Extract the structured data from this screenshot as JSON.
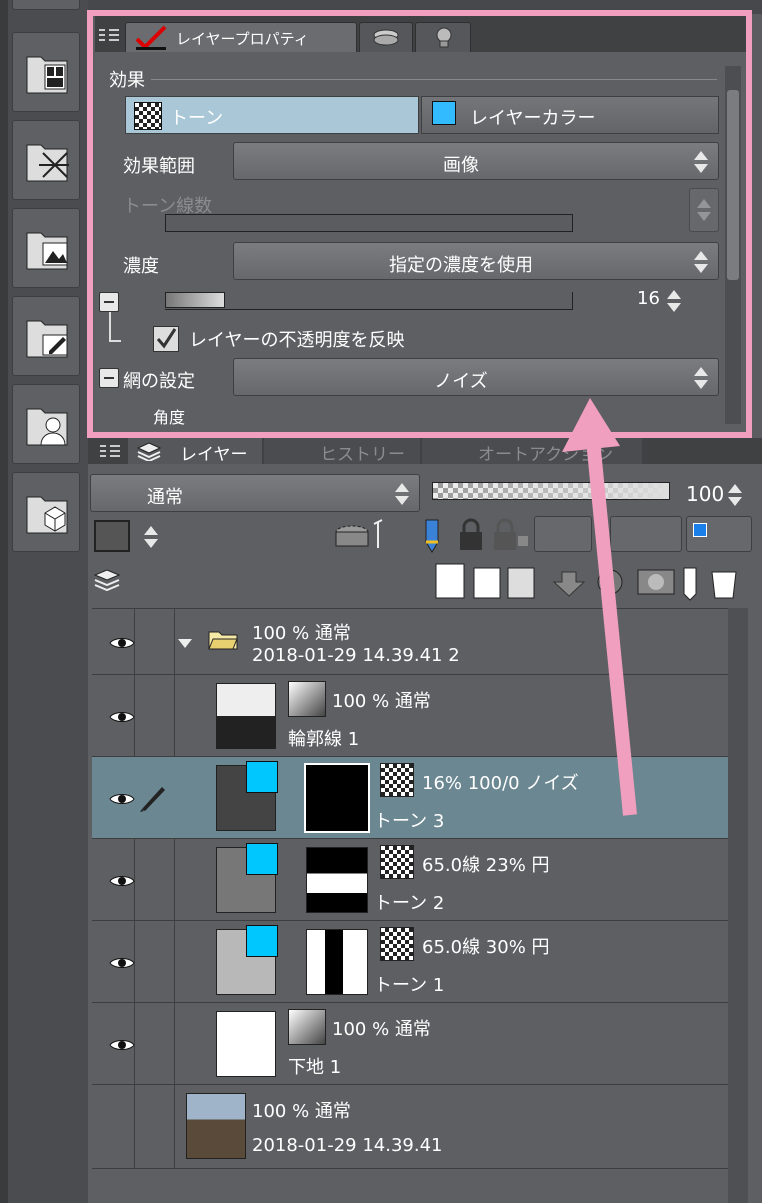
{
  "property_panel": {
    "tabs": [
      "レイヤープロパティ"
    ],
    "section_title": "効果",
    "effect_buttons": {
      "tone": "トーン",
      "layer_color": "レイヤーカラー"
    },
    "effect_range": {
      "label": "効果範囲",
      "value": "画像"
    },
    "tone_lines": {
      "label": "トーン線数"
    },
    "density": {
      "label": "濃度",
      "value": "指定の濃度を使用",
      "amount": "16"
    },
    "reflect_opacity": {
      "label": "レイヤーの不透明度を反映",
      "checked": true
    },
    "screen_setting": {
      "label": "網の設定",
      "value": "ノイズ"
    },
    "angle_label": "角度"
  },
  "layer_panel": {
    "tabs": {
      "layer": "レイヤー",
      "history": "ヒストリー",
      "auto_action": "オートアクション"
    },
    "blend_mode": "通常",
    "opacity": "100",
    "layers": [
      {
        "line1": "100 % 通常",
        "line2": "2018-01-29 14.39.41 2"
      },
      {
        "line1": "100 % 通常",
        "line2": "輪郭線 1"
      },
      {
        "line1": "16% 100/0 ノイズ",
        "line2": "トーン 3"
      },
      {
        "line1": "65.0線 23% 円",
        "line2": "トーン 2"
      },
      {
        "line1": "65.0線 30% 円",
        "line2": "トーン 1"
      },
      {
        "line1": "100 % 通常",
        "line2": "下地 1"
      },
      {
        "line1": "100 % 通常",
        "line2": "2018-01-29 14.39.41"
      }
    ]
  },
  "colors": {
    "highlight": "#f19fbf",
    "selected_row": "#6b8791",
    "tone_cyan": "#00c8ff"
  }
}
